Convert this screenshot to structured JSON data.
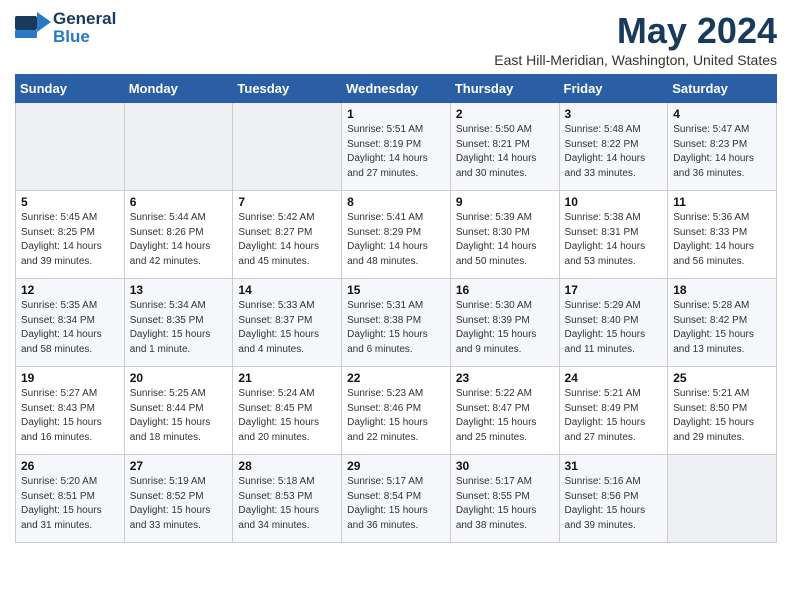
{
  "logo": {
    "line1": "General",
    "line2": "Blue"
  },
  "calendar": {
    "title": "May 2024",
    "subtitle": "East Hill-Meridian, Washington, United States"
  },
  "weekdays": [
    "Sunday",
    "Monday",
    "Tuesday",
    "Wednesday",
    "Thursday",
    "Friday",
    "Saturday"
  ],
  "weeks": [
    [
      {
        "day": "",
        "sunrise": "",
        "sunset": "",
        "daylight": "",
        "empty": true
      },
      {
        "day": "",
        "sunrise": "",
        "sunset": "",
        "daylight": "",
        "empty": true
      },
      {
        "day": "",
        "sunrise": "",
        "sunset": "",
        "daylight": "",
        "empty": true
      },
      {
        "day": "1",
        "sunrise": "Sunrise: 5:51 AM",
        "sunset": "Sunset: 8:19 PM",
        "daylight": "Daylight: 14 hours and 27 minutes."
      },
      {
        "day": "2",
        "sunrise": "Sunrise: 5:50 AM",
        "sunset": "Sunset: 8:21 PM",
        "daylight": "Daylight: 14 hours and 30 minutes."
      },
      {
        "day": "3",
        "sunrise": "Sunrise: 5:48 AM",
        "sunset": "Sunset: 8:22 PM",
        "daylight": "Daylight: 14 hours and 33 minutes."
      },
      {
        "day": "4",
        "sunrise": "Sunrise: 5:47 AM",
        "sunset": "Sunset: 8:23 PM",
        "daylight": "Daylight: 14 hours and 36 minutes."
      }
    ],
    [
      {
        "day": "5",
        "sunrise": "Sunrise: 5:45 AM",
        "sunset": "Sunset: 8:25 PM",
        "daylight": "Daylight: 14 hours and 39 minutes."
      },
      {
        "day": "6",
        "sunrise": "Sunrise: 5:44 AM",
        "sunset": "Sunset: 8:26 PM",
        "daylight": "Daylight: 14 hours and 42 minutes."
      },
      {
        "day": "7",
        "sunrise": "Sunrise: 5:42 AM",
        "sunset": "Sunset: 8:27 PM",
        "daylight": "Daylight: 14 hours and 45 minutes."
      },
      {
        "day": "8",
        "sunrise": "Sunrise: 5:41 AM",
        "sunset": "Sunset: 8:29 PM",
        "daylight": "Daylight: 14 hours and 48 minutes."
      },
      {
        "day": "9",
        "sunrise": "Sunrise: 5:39 AM",
        "sunset": "Sunset: 8:30 PM",
        "daylight": "Daylight: 14 hours and 50 minutes."
      },
      {
        "day": "10",
        "sunrise": "Sunrise: 5:38 AM",
        "sunset": "Sunset: 8:31 PM",
        "daylight": "Daylight: 14 hours and 53 minutes."
      },
      {
        "day": "11",
        "sunrise": "Sunrise: 5:36 AM",
        "sunset": "Sunset: 8:33 PM",
        "daylight": "Daylight: 14 hours and 56 minutes."
      }
    ],
    [
      {
        "day": "12",
        "sunrise": "Sunrise: 5:35 AM",
        "sunset": "Sunset: 8:34 PM",
        "daylight": "Daylight: 14 hours and 58 minutes."
      },
      {
        "day": "13",
        "sunrise": "Sunrise: 5:34 AM",
        "sunset": "Sunset: 8:35 PM",
        "daylight": "Daylight: 15 hours and 1 minute."
      },
      {
        "day": "14",
        "sunrise": "Sunrise: 5:33 AM",
        "sunset": "Sunset: 8:37 PM",
        "daylight": "Daylight: 15 hours and 4 minutes."
      },
      {
        "day": "15",
        "sunrise": "Sunrise: 5:31 AM",
        "sunset": "Sunset: 8:38 PM",
        "daylight": "Daylight: 15 hours and 6 minutes."
      },
      {
        "day": "16",
        "sunrise": "Sunrise: 5:30 AM",
        "sunset": "Sunset: 8:39 PM",
        "daylight": "Daylight: 15 hours and 9 minutes."
      },
      {
        "day": "17",
        "sunrise": "Sunrise: 5:29 AM",
        "sunset": "Sunset: 8:40 PM",
        "daylight": "Daylight: 15 hours and 11 minutes."
      },
      {
        "day": "18",
        "sunrise": "Sunrise: 5:28 AM",
        "sunset": "Sunset: 8:42 PM",
        "daylight": "Daylight: 15 hours and 13 minutes."
      }
    ],
    [
      {
        "day": "19",
        "sunrise": "Sunrise: 5:27 AM",
        "sunset": "Sunset: 8:43 PM",
        "daylight": "Daylight: 15 hours and 16 minutes."
      },
      {
        "day": "20",
        "sunrise": "Sunrise: 5:25 AM",
        "sunset": "Sunset: 8:44 PM",
        "daylight": "Daylight: 15 hours and 18 minutes."
      },
      {
        "day": "21",
        "sunrise": "Sunrise: 5:24 AM",
        "sunset": "Sunset: 8:45 PM",
        "daylight": "Daylight: 15 hours and 20 minutes."
      },
      {
        "day": "22",
        "sunrise": "Sunrise: 5:23 AM",
        "sunset": "Sunset: 8:46 PM",
        "daylight": "Daylight: 15 hours and 22 minutes."
      },
      {
        "day": "23",
        "sunrise": "Sunrise: 5:22 AM",
        "sunset": "Sunset: 8:47 PM",
        "daylight": "Daylight: 15 hours and 25 minutes."
      },
      {
        "day": "24",
        "sunrise": "Sunrise: 5:21 AM",
        "sunset": "Sunset: 8:49 PM",
        "daylight": "Daylight: 15 hours and 27 minutes."
      },
      {
        "day": "25",
        "sunrise": "Sunrise: 5:21 AM",
        "sunset": "Sunset: 8:50 PM",
        "daylight": "Daylight: 15 hours and 29 minutes."
      }
    ],
    [
      {
        "day": "26",
        "sunrise": "Sunrise: 5:20 AM",
        "sunset": "Sunset: 8:51 PM",
        "daylight": "Daylight: 15 hours and 31 minutes."
      },
      {
        "day": "27",
        "sunrise": "Sunrise: 5:19 AM",
        "sunset": "Sunset: 8:52 PM",
        "daylight": "Daylight: 15 hours and 33 minutes."
      },
      {
        "day": "28",
        "sunrise": "Sunrise: 5:18 AM",
        "sunset": "Sunset: 8:53 PM",
        "daylight": "Daylight: 15 hours and 34 minutes."
      },
      {
        "day": "29",
        "sunrise": "Sunrise: 5:17 AM",
        "sunset": "Sunset: 8:54 PM",
        "daylight": "Daylight: 15 hours and 36 minutes."
      },
      {
        "day": "30",
        "sunrise": "Sunrise: 5:17 AM",
        "sunset": "Sunset: 8:55 PM",
        "daylight": "Daylight: 15 hours and 38 minutes."
      },
      {
        "day": "31",
        "sunrise": "Sunrise: 5:16 AM",
        "sunset": "Sunset: 8:56 PM",
        "daylight": "Daylight: 15 hours and 39 minutes."
      },
      {
        "day": "",
        "sunrise": "",
        "sunset": "",
        "daylight": "",
        "empty": true
      }
    ]
  ]
}
